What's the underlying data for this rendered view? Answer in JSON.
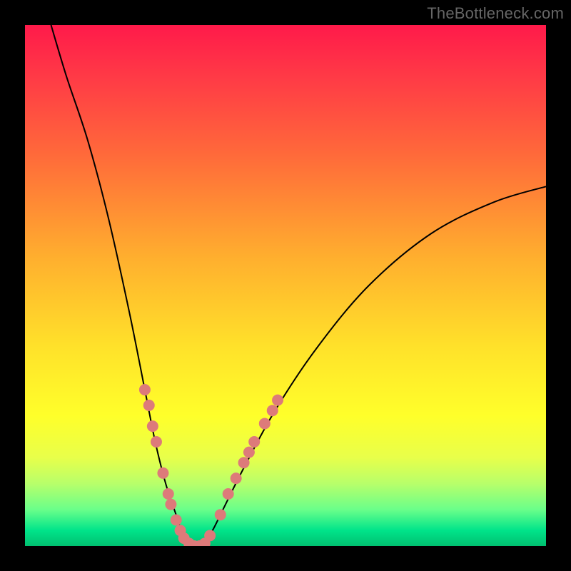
{
  "watermark": "TheBottleneck.com",
  "chart_data": {
    "type": "line",
    "title": "",
    "xlabel": "",
    "ylabel": "",
    "xlim": [
      0,
      100
    ],
    "ylim": [
      0,
      100
    ],
    "grid": false,
    "legend": false,
    "series": [
      {
        "name": "bottleneck-curve",
        "x": [
          5,
          8,
          12,
          16,
          20,
          23,
          25,
          27,
          29,
          30,
          31,
          32,
          33,
          34.5,
          36,
          38,
          42,
          48,
          56,
          66,
          78,
          90,
          100
        ],
        "y": [
          100,
          90,
          78,
          63,
          45,
          30,
          20,
          12,
          6,
          3,
          1,
          0,
          0,
          1,
          3,
          7,
          15,
          26,
          38,
          50,
          60,
          66,
          69
        ]
      }
    ],
    "markers": {
      "name": "highlighted-points",
      "color": "#dd7a7a",
      "points": [
        {
          "x": 23.0,
          "y": 30.0
        },
        {
          "x": 23.8,
          "y": 27.0
        },
        {
          "x": 24.5,
          "y": 23.0
        },
        {
          "x": 25.2,
          "y": 20.0
        },
        {
          "x": 26.5,
          "y": 14.0
        },
        {
          "x": 27.5,
          "y": 10.0
        },
        {
          "x": 28.0,
          "y": 8.0
        },
        {
          "x": 29.0,
          "y": 5.0
        },
        {
          "x": 29.8,
          "y": 3.0
        },
        {
          "x": 30.5,
          "y": 1.5
        },
        {
          "x": 31.5,
          "y": 0.5
        },
        {
          "x": 32.5,
          "y": 0.0
        },
        {
          "x": 33.5,
          "y": 0.0
        },
        {
          "x": 34.5,
          "y": 0.5
        },
        {
          "x": 35.5,
          "y": 2.0
        },
        {
          "x": 37.5,
          "y": 6.0
        },
        {
          "x": 39.0,
          "y": 10.0
        },
        {
          "x": 40.5,
          "y": 13.0
        },
        {
          "x": 42.0,
          "y": 16.0
        },
        {
          "x": 43.0,
          "y": 18.0
        },
        {
          "x": 44.0,
          "y": 20.0
        },
        {
          "x": 46.0,
          "y": 23.5
        },
        {
          "x": 47.5,
          "y": 26.0
        },
        {
          "x": 48.5,
          "y": 28.0
        }
      ]
    }
  }
}
